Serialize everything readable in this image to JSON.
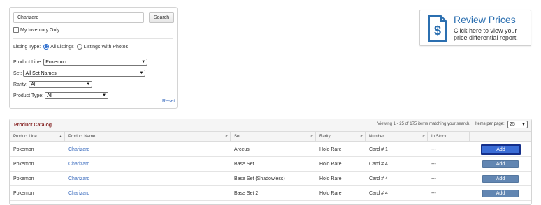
{
  "search": {
    "query": "Charizard",
    "button_label": "Search",
    "my_inventory_only_label": "My Inventory Only",
    "my_inventory_only_checked": false
  },
  "filters": {
    "listing_type_label": "Listing Type:",
    "listing_type_options": [
      "All Listings",
      "Listings With Photos"
    ],
    "listing_type_selected": "All Listings",
    "product_line_label": "Product Line:",
    "product_line_value": "Pokemon",
    "set_label": "Set:",
    "set_value": "All Set Names",
    "rarity_label": "Rarity:",
    "rarity_value": "All",
    "product_type_label": "Product Type:",
    "product_type_value": "All",
    "reset_label": "Reset"
  },
  "review_prices": {
    "title": "Review Prices",
    "description": "Click here to view your price differential report.",
    "icon": "dollar-document-icon",
    "accent_color": "#2b6fb0"
  },
  "catalog": {
    "title": "Product Catalog",
    "viewing_text": "Viewing 1 - 25 of 175 items matching your search.",
    "items_per_page_label": "Items per page:",
    "items_per_page_value": "25",
    "columns": [
      "Product Line",
      "Product Name",
      "Set",
      "Rarity",
      "Number",
      "In Stock",
      ""
    ],
    "add_label": "Add",
    "add_color": "#6286b2",
    "rows": [
      {
        "product_line": "Pokemon",
        "product_name": "Charizard",
        "set": "Arceus",
        "rarity": "Holo Rare",
        "number": "Card # 1",
        "in_stock": "---"
      },
      {
        "product_line": "Pokemon",
        "product_name": "Charizard",
        "set": "Base Set",
        "rarity": "Holo Rare",
        "number": "Card # 4",
        "in_stock": "---"
      },
      {
        "product_line": "Pokemon",
        "product_name": "Charizard",
        "set": "Base Set (Shadowless)",
        "rarity": "Holo Rare",
        "number": "Card # 4",
        "in_stock": "---"
      },
      {
        "product_line": "Pokemon",
        "product_name": "Charizard",
        "set": "Base Set 2",
        "rarity": "Holo Rare",
        "number": "Card # 4",
        "in_stock": "---"
      }
    ]
  }
}
